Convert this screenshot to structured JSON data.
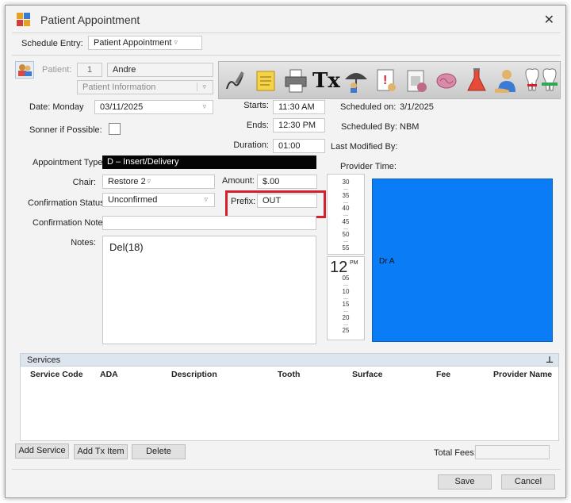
{
  "window": {
    "title": "Patient Appointment",
    "close": "✕"
  },
  "schedule_entry": {
    "label": "Schedule Entry:",
    "value": "Patient Appointment"
  },
  "patient": {
    "label": "Patient:",
    "id": "1",
    "name": "Andre",
    "info": "Patient Information"
  },
  "toolbar": {
    "icons": [
      "signature-icon",
      "notes-icon",
      "printer-icon",
      "tx-icon",
      "insurance-umbrella-icon",
      "medical-alert-icon",
      "xray-icon",
      "brain-icon",
      "lab-flask-icon",
      "patient-hand-icon",
      "tooth-icon",
      "perio-chart-icon"
    ],
    "tx_label": "Tx"
  },
  "date": {
    "label": "Date: Monday",
    "value": "03/11/2025"
  },
  "sooner": {
    "label": "Sonner if Possible:"
  },
  "times": {
    "starts_label": "Starts:",
    "starts": "11:30 AM",
    "ends_label": "Ends:",
    "ends": "12:30 PM",
    "duration_label": "Duration:",
    "duration": "01:00"
  },
  "meta": {
    "scheduled_on_label": "Scheduled on:",
    "scheduled_on": "3/1/2025",
    "scheduled_by_label": "Scheduled By:",
    "scheduled_by": "NBM",
    "last_modified_label": "Last Modified By:",
    "provider_time_label": "Provider Time:"
  },
  "appointment_type": {
    "label": "Appointment Type:",
    "value": "D – Insert/Delivery"
  },
  "chair": {
    "label": "Chair:",
    "value": "Restore 2"
  },
  "amount": {
    "label": "Amount:",
    "value": "$.00"
  },
  "confirmation_status": {
    "label": "Confirmation Status:",
    "value": "Unconfirmed"
  },
  "prefix": {
    "label": "Prefix:",
    "value": "OUT"
  },
  "confirmation_note": {
    "label": "Confirmation Note:",
    "value": ""
  },
  "notes": {
    "label": "Notes:",
    "value": "Del(18)"
  },
  "timeline": {
    "top_ticks": [
      "30",
      "35",
      "40",
      "45",
      "50",
      "55"
    ],
    "hour": "12",
    "ampm": "PM",
    "bottom_ticks": [
      "05",
      "10",
      "15",
      "20",
      "25"
    ]
  },
  "provider_block": {
    "label": "Dr A",
    "color": "#0a7cf5"
  },
  "services": {
    "title": "Services",
    "pin": "⊥",
    "columns": [
      "Service Code",
      "ADA",
      "Description",
      "Tooth",
      "Surface",
      "Fee",
      "Provider Name"
    ]
  },
  "buttons": {
    "add_service": "Add Service",
    "add_tx": "Add Tx Item",
    "delete": "Delete",
    "save": "Save",
    "cancel": "Cancel"
  },
  "total_fees": {
    "label": "Total Fees::",
    "value": ""
  },
  "colors": {
    "highlight": "#d61f2a",
    "provider": "#0a7cf5"
  }
}
